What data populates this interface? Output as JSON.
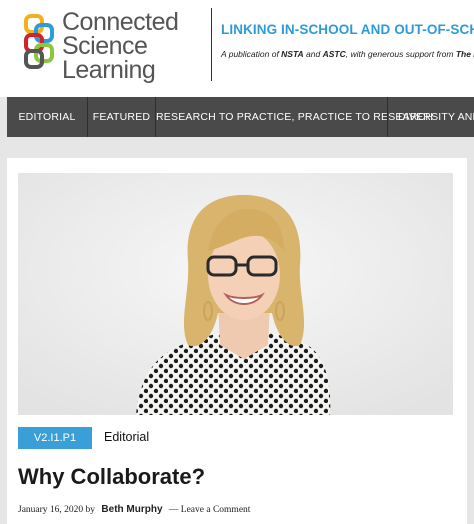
{
  "brand": {
    "logo_lines": [
      "Connected",
      "Science",
      "Learning"
    ],
    "tagline": "LINKING IN-SCHOOL AND OUT-OF-SCHOOL ST",
    "pub_prefix": "A publication of ",
    "pub_org1": "NSTA",
    "pub_and": " and ",
    "pub_org2": "ASTC",
    "pub_mid": ", with generous support from ",
    "pub_org3": "The Kavl",
    "colors": {
      "blue": "#2f9bd6",
      "green": "#8cc63f",
      "red": "#d2232a",
      "gold": "#f2b01e",
      "gray": "#555555"
    }
  },
  "nav": {
    "items": [
      "EDITORIAL",
      "FEATURED",
      "RESEARCH TO PRACTICE, PRACTICE TO RESEARCH",
      "DIVERSITY AND EQ"
    ]
  },
  "article": {
    "badge": "V2.I1.P1",
    "category": "Editorial",
    "title": "Why Collaborate?",
    "date": "January 16, 2020",
    "by": "by",
    "author": "Beth Murphy",
    "dash": "—",
    "comment_link": "Leave a Comment",
    "image_alt": "woman-portrait-image"
  }
}
